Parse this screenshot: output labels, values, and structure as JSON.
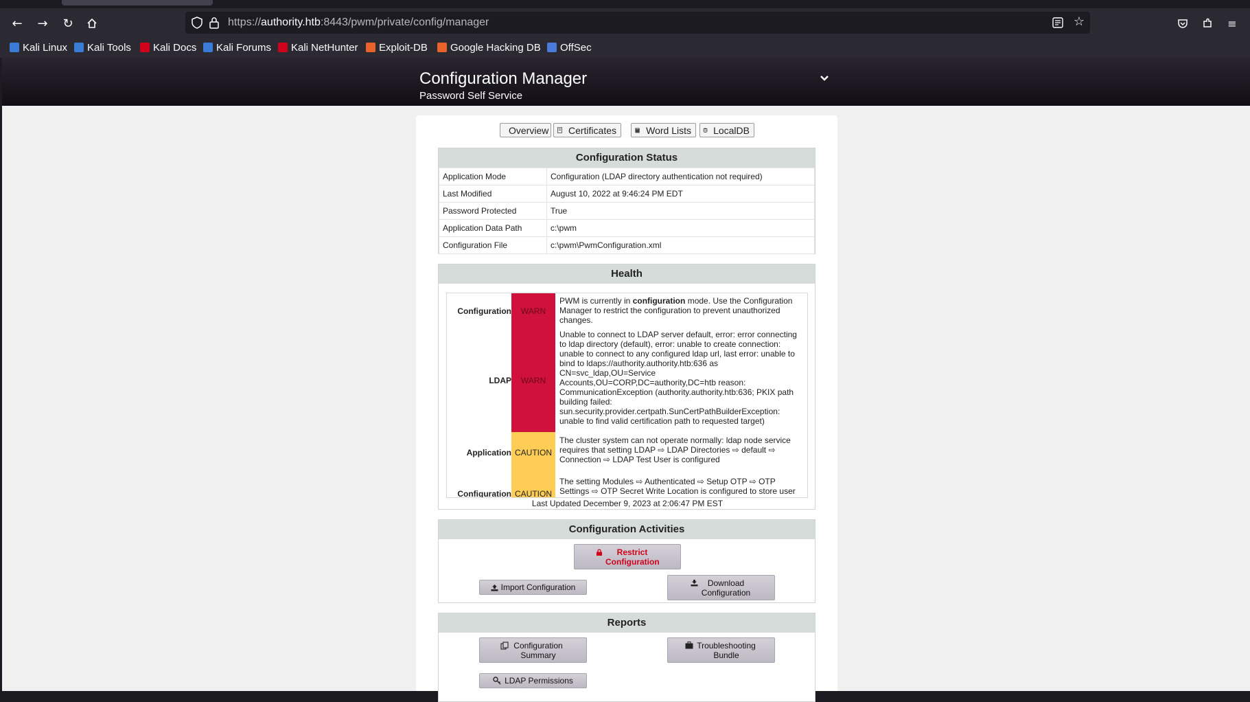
{
  "browser": {
    "url_prefix": "https://",
    "url_host": "authority.htb",
    "url_rest": ":8443/pwm/private/config/manager",
    "bookmarks": [
      {
        "label": "Kali Linux",
        "icon": "kali-dragon-icon",
        "color": "#3a7bd5"
      },
      {
        "label": "Kali Tools",
        "icon": "kali-tools-icon",
        "color": "#3a7bd5"
      },
      {
        "label": "Kali Docs",
        "icon": "kali-docs-icon",
        "color": "#d0021b"
      },
      {
        "label": "Kali Forums",
        "icon": "kali-forums-icon",
        "color": "#3a7bd5"
      },
      {
        "label": "Kali NetHunter",
        "icon": "nethunter-icon",
        "color": "#d0021b"
      },
      {
        "label": "Exploit-DB",
        "icon": "exploit-db-icon",
        "color": "#e8622a"
      },
      {
        "label": "Google Hacking DB",
        "icon": "ghdb-icon",
        "color": "#e8622a"
      },
      {
        "label": "OffSec",
        "icon": "offsec-icon",
        "color": "#4a7bd8"
      }
    ]
  },
  "header": {
    "title": "Configuration Manager",
    "subtitle": "Password Self Service"
  },
  "tabs": [
    {
      "label": "Overview",
      "icon": "dashboard-icon"
    },
    {
      "label": "Certificates",
      "icon": "certificate-icon"
    },
    {
      "label": "Word Lists",
      "icon": "book-icon"
    },
    {
      "label": "LocalDB",
      "icon": "database-icon"
    }
  ],
  "status": {
    "heading": "Configuration Status",
    "rows": [
      {
        "key": "Application Mode",
        "value": "Configuration (LDAP directory authentication not required)"
      },
      {
        "key": "Last Modified",
        "value": "August 10, 2022 at 9:46:24 PM EDT"
      },
      {
        "key": "Password Protected",
        "value": "True"
      },
      {
        "key": "Application Data Path",
        "value": "c:\\pwm"
      },
      {
        "key": "Configuration File",
        "value": "c:\\pwm\\PwmConfiguration.xml"
      }
    ]
  },
  "health": {
    "heading": "Health",
    "items": [
      {
        "topic": "Configuration",
        "status": "WARN",
        "pre": "PWM is currently in ",
        "bold": "configuration",
        "post": " mode. Use the Configuration Manager to restrict the configuration to prevent unauthorized changes."
      },
      {
        "topic": "LDAP",
        "status": "WARN",
        "message": "Unable to connect to LDAP server default, error: error connecting to ldap directory (default), error: unable to create connection: unable to connect to any configured ldap url, last error: unable to bind to ldaps://authority.authority.htb:636 as CN=svc_ldap,OU=Service Accounts,OU=CORP,DC=authority,DC=htb reason: CommunicationException (authority.authority.htb:636; PKIX path building failed: sun.security.provider.certpath.SunCertPathBuilderException: unable to find valid certification path to requested target)"
      },
      {
        "topic": "Application",
        "status": "CAUTION",
        "message": "The cluster system can not operate normally: ldap node service requires that setting LDAP ⇨ LDAP Directories ⇨ default ⇨ Connection ⇨ LDAP Test User is configured"
      },
      {
        "topic": "Configuration",
        "status": "CAUTION",
        "message": "The setting Modules ⇨ Authenticated ⇨ Setup OTP ⇨ OTP Settings ⇨ OTP Secret Write Location is configured to store user data in the LocalDB. This should never be used in a production environment."
      }
    ],
    "last_updated": "Last Updated December 9, 2023 at 2:06:47 PM EST"
  },
  "activities": {
    "heading": "Configuration Activities",
    "restrict_label": "Restrict Configuration",
    "import_label": "Import Configuration",
    "download_label": "Download Configuration"
  },
  "reports": {
    "heading": "Reports",
    "summary_label": "Configuration Summary",
    "bundle_label": "Troubleshooting Bundle",
    "ldap_permissions_label": "LDAP Permissions"
  },
  "colors": {
    "warn": "#d0113b",
    "caution": "#ffcc55",
    "section_header": "#d5dcda",
    "restrict_text": "#d0021b"
  }
}
